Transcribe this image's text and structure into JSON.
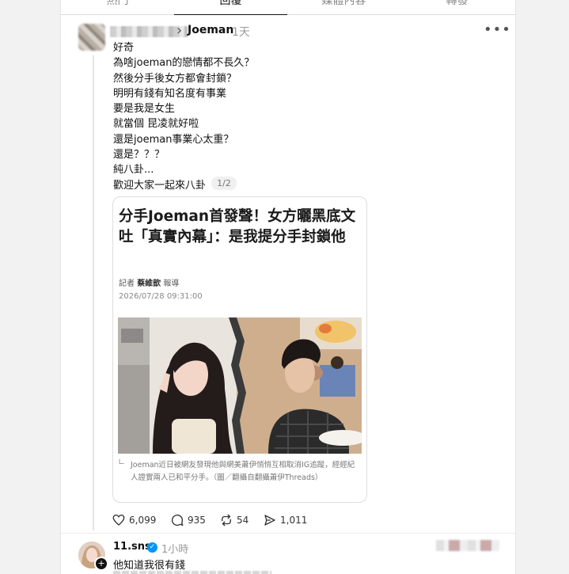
{
  "tabs": [
    "熱門",
    "回覆",
    "媒體內容",
    "轉發"
  ],
  "post": {
    "reply_to": "Joeman",
    "time": "1天",
    "lines": [
      "好奇",
      "為啥joeman的戀情都不長久？",
      "然後分手後女方都會封鎖？",
      "明明有錢有知名度有事業",
      "要是我是女生",
      "就當個 昆凌就好啦",
      "還是joeman事業心太重？",
      "還是？？？",
      "純八卦...",
      "歡迎大家一起來八卦"
    ],
    "page_indicator": "1/2",
    "article": {
      "headline": "分手Joeman首發聲！女方曬黑底文吐「真實內幕」：是我提分手封鎖他",
      "reporter_prefix": "記者",
      "reporter_name": "蔡維歆",
      "reporter_suffix": "報導",
      "date": "2026/07/28 09:31:00",
      "caption": "Joeman近日被網友發現他與網美蕭伊悄悄互相取消IG追蹤，經經紀人證實兩人已和平分手。（圖／翻攝自翻攝蕭伊Threads）"
    },
    "stats": {
      "likes": "6,099",
      "comments": "935",
      "reposts": "54",
      "shares": "1,011"
    }
  },
  "reply": {
    "username": "11.sns",
    "time": "1小時",
    "text": "他知道我很有錢"
  }
}
